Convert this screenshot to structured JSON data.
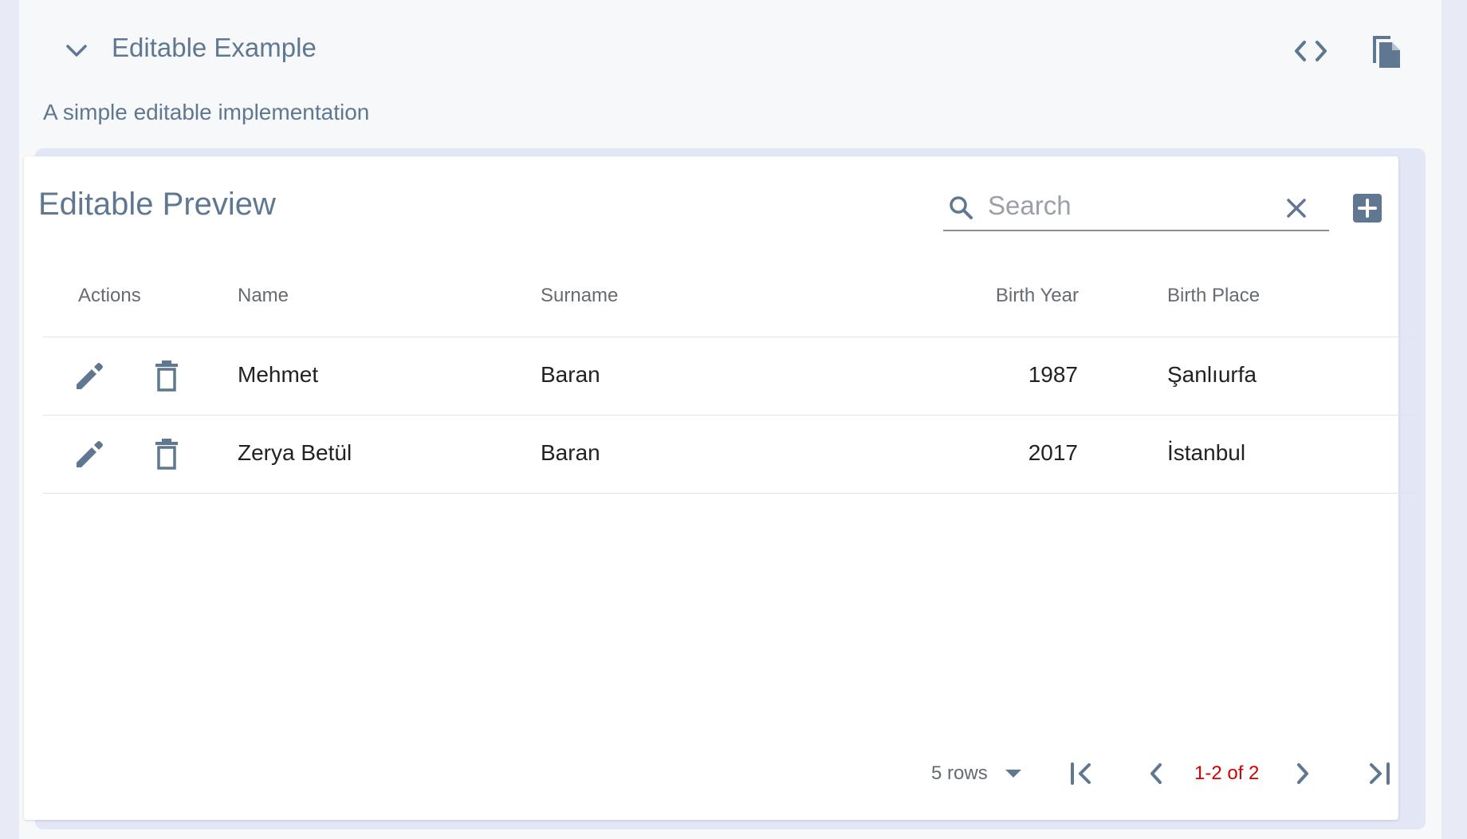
{
  "example": {
    "title": "Editable Example",
    "description": "A simple editable implementation"
  },
  "card": {
    "title": "Editable Preview",
    "search_placeholder": "Search"
  },
  "table": {
    "columns": [
      "Actions",
      "Name",
      "Surname",
      "Birth Year",
      "Birth Place"
    ],
    "rows": [
      {
        "name": "Mehmet",
        "surname": "Baran",
        "birth_year": "1987",
        "birth_place": "Şanlıurfa"
      },
      {
        "name": "Zerya Betül",
        "surname": "Baran",
        "birth_year": "2017",
        "birth_place": "İstanbul"
      }
    ]
  },
  "pagination": {
    "rows_per_page": "5 rows",
    "page_info": "1-2 of 2"
  },
  "icons": {
    "collapse": "chevron-down-icon",
    "code": "code-icon",
    "copy": "copy-icon",
    "search": "search-icon",
    "clear": "close-icon",
    "add": "add-box-icon",
    "edit": "edit-icon",
    "delete": "delete-icon",
    "first_page": "first-page-icon",
    "previous_page": "chevron-left-icon",
    "next_page": "chevron-right-icon",
    "last_page": "last-page-icon"
  },
  "colors": {
    "accent": "#5f7791",
    "page_info": "#d50000",
    "background": "#e8eaf6"
  }
}
